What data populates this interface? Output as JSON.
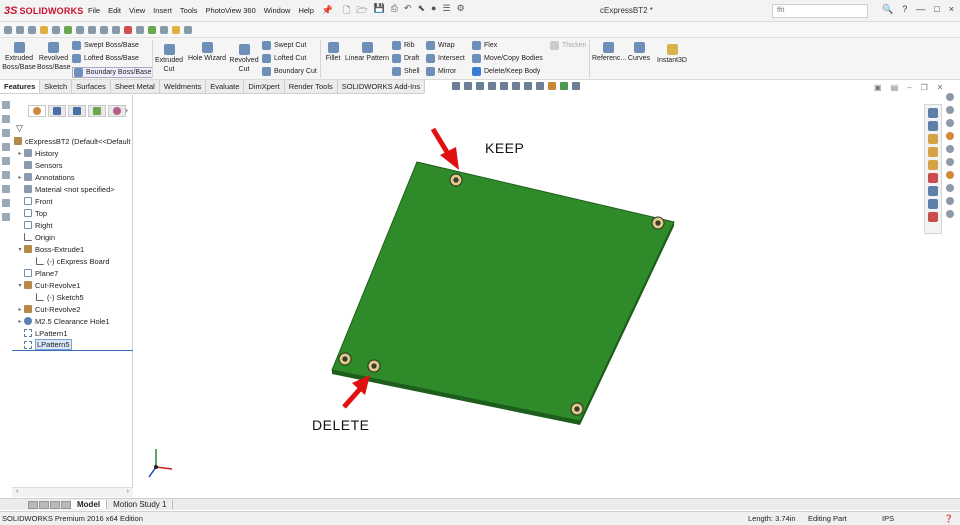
{
  "app": {
    "brand": "SOLIDWORKS",
    "document_title": "cExpressBT2 *",
    "search_placeholder": "ffit",
    "menus": [
      "File",
      "Edit",
      "View",
      "Insert",
      "Tools",
      "PhotoView 360",
      "Window",
      "Help"
    ],
    "window_controls": [
      "?",
      "-",
      "—",
      "□",
      "×"
    ]
  },
  "ribbon": {
    "extruded_boss": "Extruded Boss/Base",
    "revolved_boss": "Revolved Boss/Base",
    "swept_boss": "Swept Boss/Base",
    "lofted_boss": "Lofted Boss/Base",
    "boundary_boss": "Boundary Boss/Base",
    "extruded_cut": "Extruded Cut",
    "hole_wizard": "Hole Wizard",
    "revolved_cut": "Revolved Cut",
    "swept_cut": "Swept Cut",
    "lofted_cut": "Lofted Cut",
    "boundary_cut": "Boundary Cut",
    "fillet": "Fillet",
    "linear_pattern": "Linear Pattern",
    "rib": "Rib",
    "draft": "Draft",
    "shell": "Shell",
    "wrap": "Wrap",
    "intersect": "Intersect",
    "mirror": "Mirror",
    "flex": "Flex",
    "move_copy": "Move/Copy Bodies",
    "delete_keep": "Delete/Keep Body",
    "thicken": "Thicken",
    "reference": "Referenc...",
    "curves": "Curves",
    "instant3d": "Instant3D"
  },
  "tabs": [
    "Features",
    "Sketch",
    "Surfaces",
    "Sheet Metal",
    "Weldments",
    "Evaluate",
    "DimXpert",
    "Render Tools",
    "SOLIDWORKS Add-Ins"
  ],
  "tree": {
    "root": "cExpressBT2  (Default<<Default",
    "items": [
      {
        "label": "History",
        "expand": "▸"
      },
      {
        "label": "Sensors",
        "expand": ""
      },
      {
        "label": "Annotations",
        "expand": "▸"
      },
      {
        "label": "Material <not specified>",
        "expand": ""
      },
      {
        "label": "Front",
        "expand": ""
      },
      {
        "label": "Top",
        "expand": ""
      },
      {
        "label": "Right",
        "expand": ""
      },
      {
        "label": "Origin",
        "expand": ""
      },
      {
        "label": "Boss-Extrude1",
        "expand": "▾"
      },
      {
        "label": "(-) cExpress Board",
        "expand": ""
      },
      {
        "label": "Plane7",
        "expand": ""
      },
      {
        "label": "Cut-Revolve1",
        "expand": "▾"
      },
      {
        "label": "(-) Sketch5",
        "expand": ""
      },
      {
        "label": "Cut-Revolve2",
        "expand": "▸"
      },
      {
        "label": "M2.5 Clearance Hole1",
        "expand": "▸"
      },
      {
        "label": "LPattern1",
        "expand": ""
      },
      {
        "label": "LPattern5",
        "expand": ""
      }
    ]
  },
  "annotations": {
    "keep": "KEEP",
    "delete": "DELETE"
  },
  "bottom_tabs": [
    "Model",
    "Motion Study 1"
  ],
  "status": {
    "edition": "SOLIDWORKS Premium 2016 x64 Edition",
    "length": "Length: 3.74in",
    "mode": "Editing Part",
    "units": "IPS"
  },
  "colors": {
    "board": "#2f8a2a",
    "board_edge": "#1e5e1c",
    "arrow": "#e01010",
    "brand": "#c8102e"
  }
}
